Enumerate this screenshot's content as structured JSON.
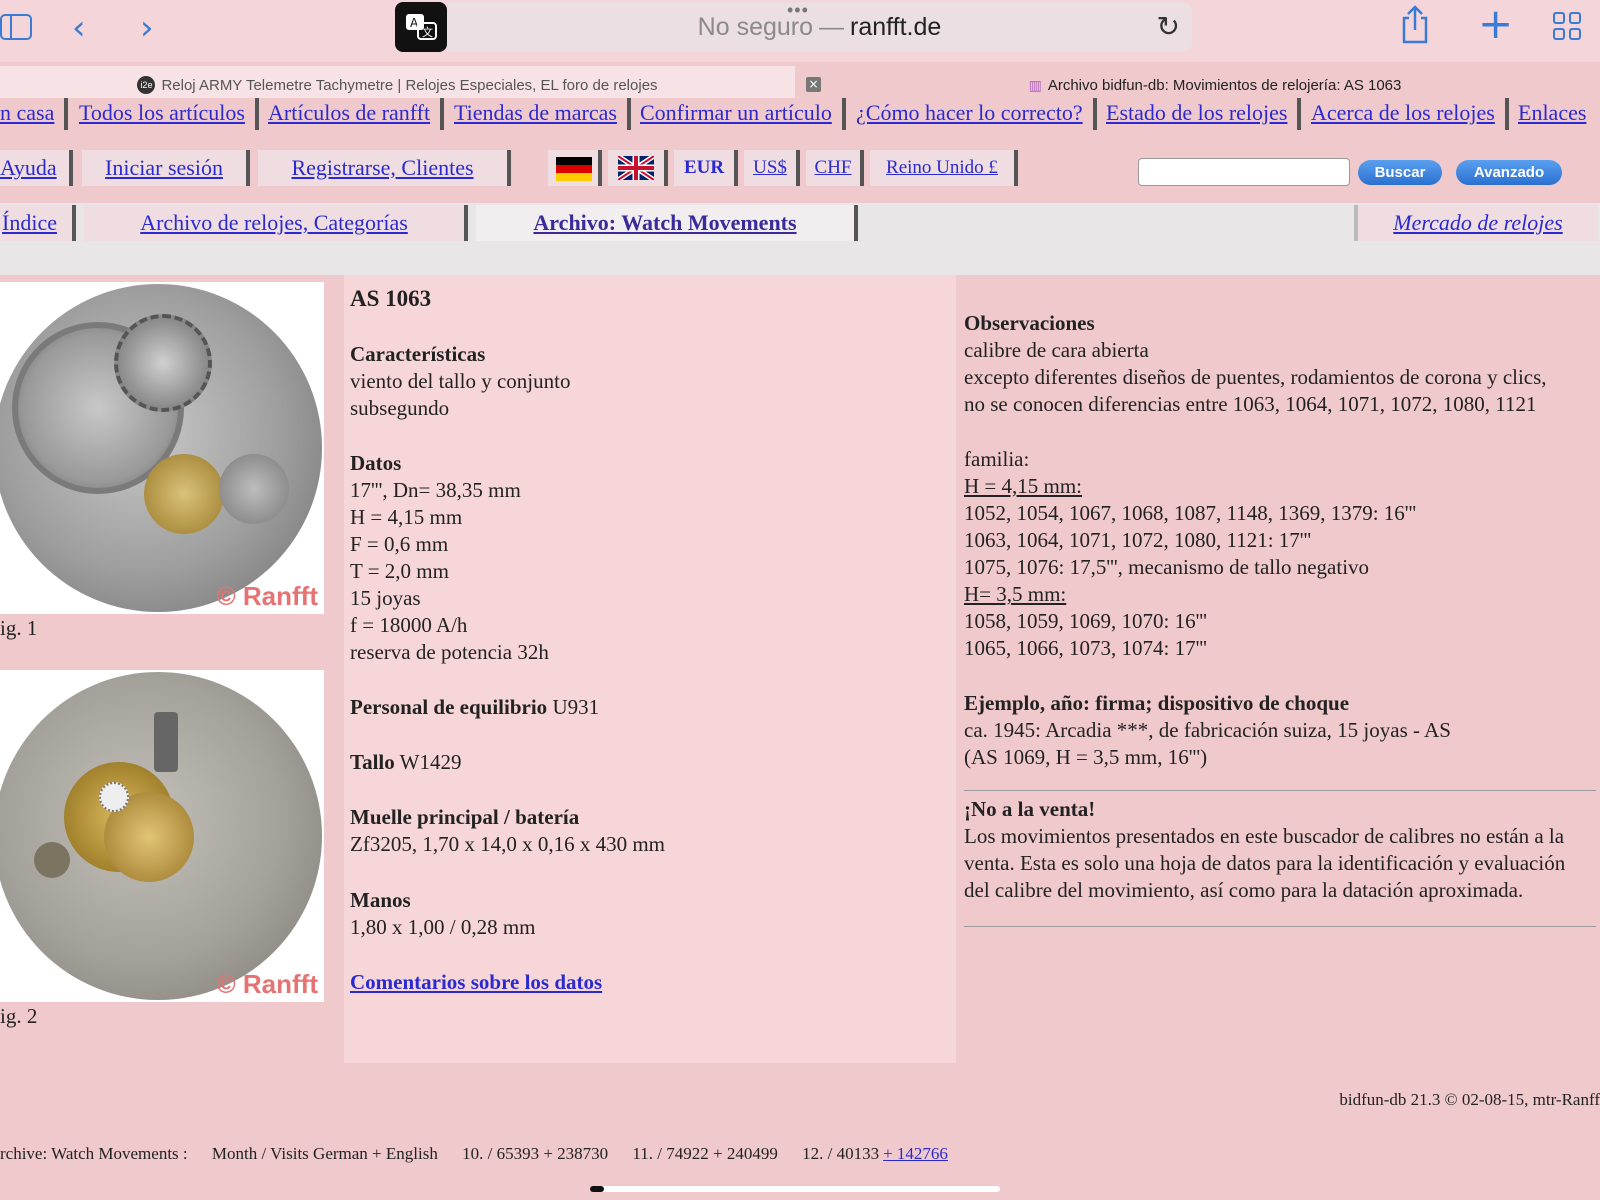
{
  "browser": {
    "address": {
      "insecure": "No seguro",
      "separator": "—",
      "host": "ranfft.de"
    },
    "tabs": [
      {
        "favicon": "i2e",
        "title": "Reloj ARMY Telemetre Tachymetre | Relojes Especiales, EL foro de relojes"
      },
      {
        "title": "Archivo bidfun-db: Movimientos de relojería: AS 1063"
      }
    ],
    "icons": {
      "sidebar": "sidebar-icon",
      "back": "‹",
      "forward": "›",
      "translate": "translate-icon",
      "reload": "↻",
      "share": "share-icon",
      "new_tab": "+",
      "tabs": "tabs-overview-icon",
      "close_tab": "×"
    }
  },
  "nav": {
    "row1": [
      "n casa",
      "Todos los artículos",
      "Artículos de ranfft",
      "Tiendas de marcas",
      "Confirmar un artículo",
      "¿Cómo hacer lo correcto?",
      "Estado de los relojes",
      "Acerca de los relojes",
      "Enlaces"
    ],
    "row2": {
      "help": "Ayuda",
      "login": "Iniciar sesión",
      "register": "Registrarse, Clientes",
      "flags": [
        "de-flag",
        "uk-flag"
      ],
      "currencies": [
        "EUR",
        "US$",
        "CHF",
        "Reino Unido £"
      ],
      "search_button": "Buscar",
      "advanced_button": "Avanzado"
    },
    "row3": [
      "Índice",
      "Archivo de relojes, Categorías",
      "Archivo: Watch Movements",
      "Mercado de relojes"
    ]
  },
  "figures": [
    {
      "caption": "ig. 1",
      "copyright": "© Ranfft"
    },
    {
      "caption": "ig. 2",
      "copyright": "© Ranfft"
    }
  ],
  "movement": {
    "title": "AS 1063",
    "features_heading": "Características",
    "features": [
      "viento del tallo y conjunto",
      "subsegundo"
    ],
    "data_heading": "Datos",
    "data": [
      "17''', Dn= 38,35 mm",
      "H = 4,15 mm",
      "F = 0,6 mm",
      "T = 2,0 mm",
      "15 joyas",
      "f = 18000 A/h",
      "reserva de potencia 32h"
    ],
    "balance_label": "Personal de equilibrio",
    "balance_value": "U931",
    "stem_label": "Tallo",
    "stem_value": "W1429",
    "mainspring_heading": "Muelle principal / batería",
    "mainspring": "Zf3205, 1,70 x 14,0 x 0,16 x 430 mm",
    "hands_heading": "Manos",
    "hands": "1,80 x 1,00 / 0,28 mm",
    "feedback_link": "Comentarios sobre los datos"
  },
  "remarks": {
    "heading": "Observaciones",
    "lines": [
      "calibre de cara abierta",
      "excepto diferentes diseños de puentes, rodamientos de corona y clics,",
      "no se conocen diferencias entre 1063, 1064, 1071, 1072, 1080, 1121"
    ],
    "family_label": "familia:",
    "h1": "H = 4,15 mm:",
    "h1_lines": [
      "1052, 1054, 1067, 1068, 1087, 1148, 1369, 1379: 16'''",
      "1063, 1064, 1071, 1072, 1080, 1121: 17'''",
      "1075, 1076: 17,5''', mecanismo de tallo negativo"
    ],
    "h2": "H= 3,5 mm:",
    "h2_lines": [
      "1058, 1059, 1069, 1070: 16'''",
      "1065, 1066, 1073, 1074: 17'''"
    ],
    "example_heading": "Ejemplo, año: firma; dispositivo de choque",
    "example_lines": [
      "ca. 1945: Arcadia ***, de fabricación suiza, 15 joyas - AS",
      "(AS 1069, H = 3,5 mm, 16''')"
    ],
    "notforsale_heading": "¡No a la venta!",
    "notforsale_lines": [
      "Los movimientos presentados en este buscador de calibres no están a la",
      "venta. Esta es solo una hoja de datos para la identificación y evaluación",
      "del calibre del movimiento, así como para la datación aproximada."
    ]
  },
  "footer": {
    "version": "bidfun-db 21.3 © 02-08-15, mtr-Ranff",
    "stats_label": "rchive: Watch Movements :",
    "stats_header": "Month / Visits German + English",
    "stats": [
      "10. / 65393 + 238730",
      "11. / 74922 + 240499",
      "12. / 40133"
    ],
    "stats_link": "+ 142766"
  }
}
